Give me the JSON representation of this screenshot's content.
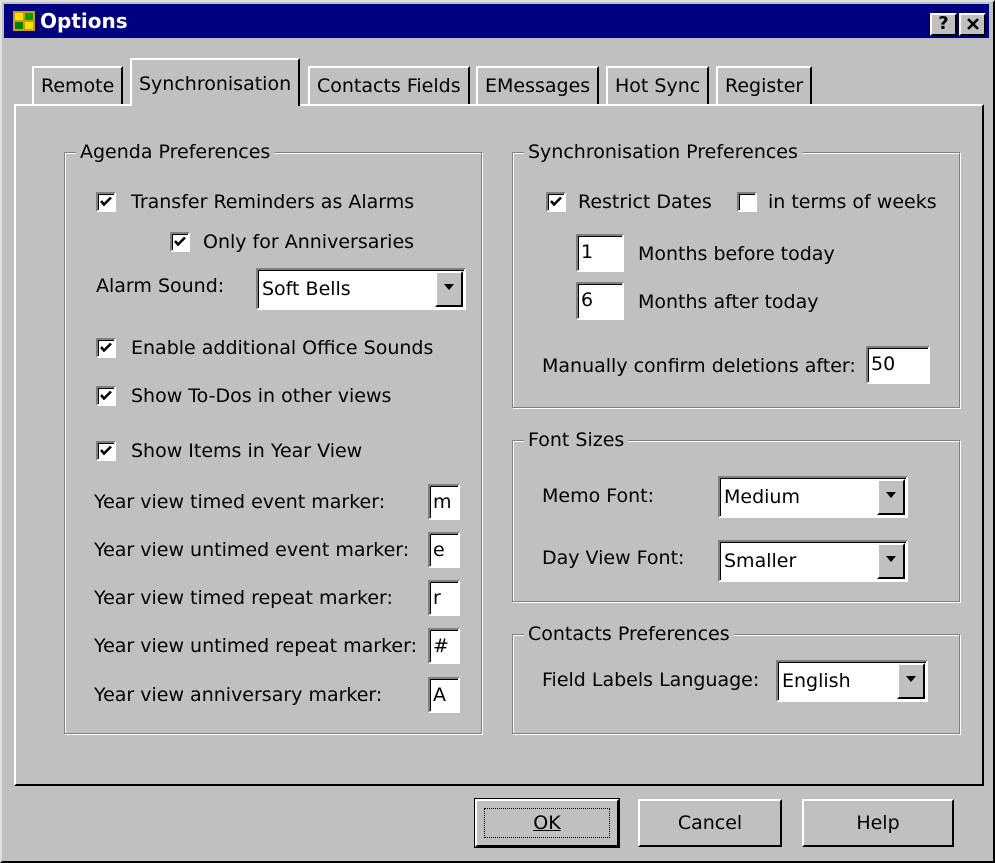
{
  "window": {
    "title": "Options",
    "help_btn": "?",
    "close_btn": "✕"
  },
  "tabs": [
    {
      "label": "Remote"
    },
    {
      "label": "Synchronisation"
    },
    {
      "label": "Contacts Fields"
    },
    {
      "label": "EMessages"
    },
    {
      "label": "Hot Sync"
    },
    {
      "label": "Register"
    }
  ],
  "active_tab": "Synchronisation",
  "agenda": {
    "legend": "Agenda Preferences",
    "transfer_reminders": {
      "label": "Transfer Reminders as Alarms",
      "checked": true
    },
    "only_anniversaries": {
      "label": "Only for Anniversaries",
      "checked": true
    },
    "alarm_sound_label": "Alarm Sound:",
    "alarm_sound_value": "Soft Bells",
    "office_sounds": {
      "label": "Enable additional Office Sounds",
      "checked": true
    },
    "show_todos": {
      "label": "Show To-Dos in other views",
      "checked": true
    },
    "show_items_year": {
      "label": "Show Items in Year View",
      "checked": true
    },
    "markers": [
      {
        "label": "Year view timed event marker:",
        "value": "m"
      },
      {
        "label": "Year view untimed event marker:",
        "value": "e"
      },
      {
        "label": "Year view timed repeat marker:",
        "value": "r"
      },
      {
        "label": "Year view untimed repeat marker:",
        "value": "#"
      },
      {
        "label": "Year view anniversary marker:",
        "value": "A"
      }
    ]
  },
  "sync": {
    "legend": "Synchronisation Preferences",
    "restrict_dates": {
      "label": "Restrict Dates",
      "checked": true
    },
    "in_weeks": {
      "label": "in terms of weeks",
      "checked": false
    },
    "months_before": {
      "value": "1",
      "label": "Months before today"
    },
    "months_after": {
      "value": "6",
      "label": "Months after today"
    },
    "confirm_label": "Manually confirm deletions after:",
    "confirm_value": "50"
  },
  "fonts": {
    "legend": "Font Sizes",
    "memo_label": "Memo Font:",
    "memo_value": "Medium",
    "dayview_label": "Day View Font:",
    "dayview_value": "Smaller"
  },
  "contacts": {
    "legend": "Contacts Preferences",
    "language_label": "Field Labels Language:",
    "language_value": "English"
  },
  "buttons": {
    "ok": "OK",
    "cancel": "Cancel",
    "help": "Help"
  }
}
